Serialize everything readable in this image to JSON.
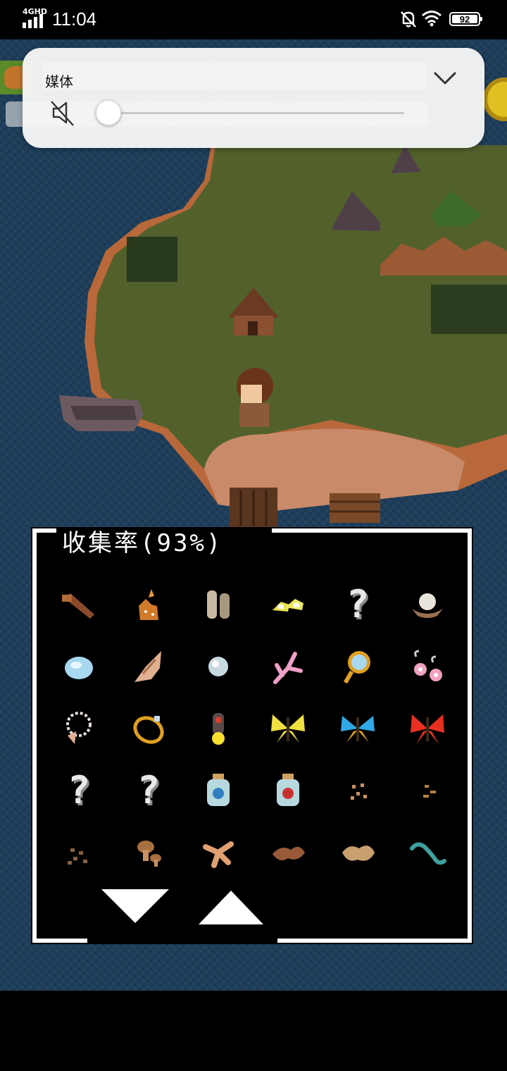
{
  "status_bar": {
    "network": "4GHD",
    "time": "11:04",
    "battery": "92",
    "icons": [
      "signal-icon",
      "bell-muted-icon",
      "wifi-icon",
      "battery-icon"
    ]
  },
  "media_panel": {
    "label": "媒体",
    "volume": 0,
    "icons": [
      "speaker-muted-icon",
      "chevron-down-icon"
    ]
  },
  "collection": {
    "title": "收集率(93%)",
    "rate_percent": 93,
    "items": [
      {
        "icon": "wood-stick-icon",
        "known": true
      },
      {
        "icon": "deer-icon",
        "known": true
      },
      {
        "icon": "bones-icon",
        "known": true
      },
      {
        "icon": "shoes-icon",
        "known": true
      },
      {
        "icon": "unknown-item",
        "known": false,
        "label": "?"
      },
      {
        "icon": "shell-pearl-icon",
        "known": true
      },
      {
        "icon": "crystal-egg-icon",
        "known": true
      },
      {
        "icon": "conch-shell-icon",
        "known": true
      },
      {
        "icon": "pearl-icon",
        "known": true
      },
      {
        "icon": "coral-icon",
        "known": true
      },
      {
        "icon": "mirror-icon",
        "known": true
      },
      {
        "icon": "earrings-icon",
        "known": true
      },
      {
        "icon": "shell-necklace-icon",
        "known": true
      },
      {
        "icon": "gold-ring-icon",
        "known": true
      },
      {
        "icon": "firefly-icon",
        "known": true
      },
      {
        "icon": "yellow-butterfly-icon",
        "known": true
      },
      {
        "icon": "blue-butterfly-icon",
        "known": true
      },
      {
        "icon": "red-butterfly-icon",
        "known": true
      },
      {
        "icon": "unknown-item",
        "known": false,
        "label": "?"
      },
      {
        "icon": "unknown-item",
        "known": false,
        "label": "?"
      },
      {
        "icon": "jar-blue-icon",
        "known": true
      },
      {
        "icon": "jar-red-icon",
        "known": true
      },
      {
        "icon": "seeds-icon",
        "known": true
      },
      {
        "icon": "small-seeds-icon",
        "known": true
      },
      {
        "icon": "soil-icon",
        "known": true
      },
      {
        "icon": "mushrooms-icon",
        "known": true
      },
      {
        "icon": "ginger-icon",
        "known": true
      },
      {
        "icon": "brown-roots-icon",
        "known": true
      },
      {
        "icon": "tan-roots-icon",
        "known": true
      },
      {
        "icon": "worm-icon",
        "known": true
      }
    ],
    "nav": {
      "down": "scroll-down-arrow",
      "up": "scroll-up-arrow"
    }
  }
}
